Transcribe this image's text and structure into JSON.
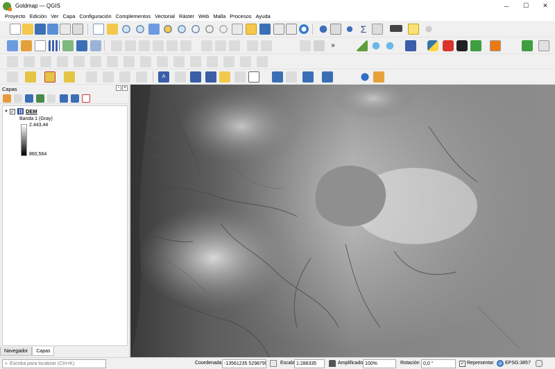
{
  "window": {
    "title": "Goldmap — QGIS",
    "minimize": "─",
    "maximize": "☐",
    "close": "✕"
  },
  "menu": [
    "Proyecto",
    "Edición",
    "Ver",
    "Capa",
    "Configuración",
    "Complementos",
    "Vectorial",
    "Ráster",
    "Web",
    "Malla",
    "Procesos",
    "Ayuda"
  ],
  "layers_panel": {
    "title": "Capas",
    "layer": {
      "name": "DEM",
      "checked": true,
      "band": "Banda 1 (Gray)",
      "max": "2.443,44",
      "min": "860,564"
    },
    "tabs": [
      "Navegador",
      "Capas"
    ]
  },
  "statusbar": {
    "locator_placeholder": "Escriba para localizar (Ctrl+K)",
    "coord_label": "Coordenada",
    "coord_value": "-13561235  5298795",
    "scale_label": "Escala",
    "scale_value": "1:286335",
    "magnifier_label": "Amplificador",
    "magnifier_value": "100%",
    "rotation_label": "Rotación",
    "rotation_value": "0,0 °",
    "render_label": "Representar",
    "crs": "EPSG:3857"
  },
  "colors": {
    "qgis_green": "#589632",
    "qgis_orange": "#ee7913"
  }
}
